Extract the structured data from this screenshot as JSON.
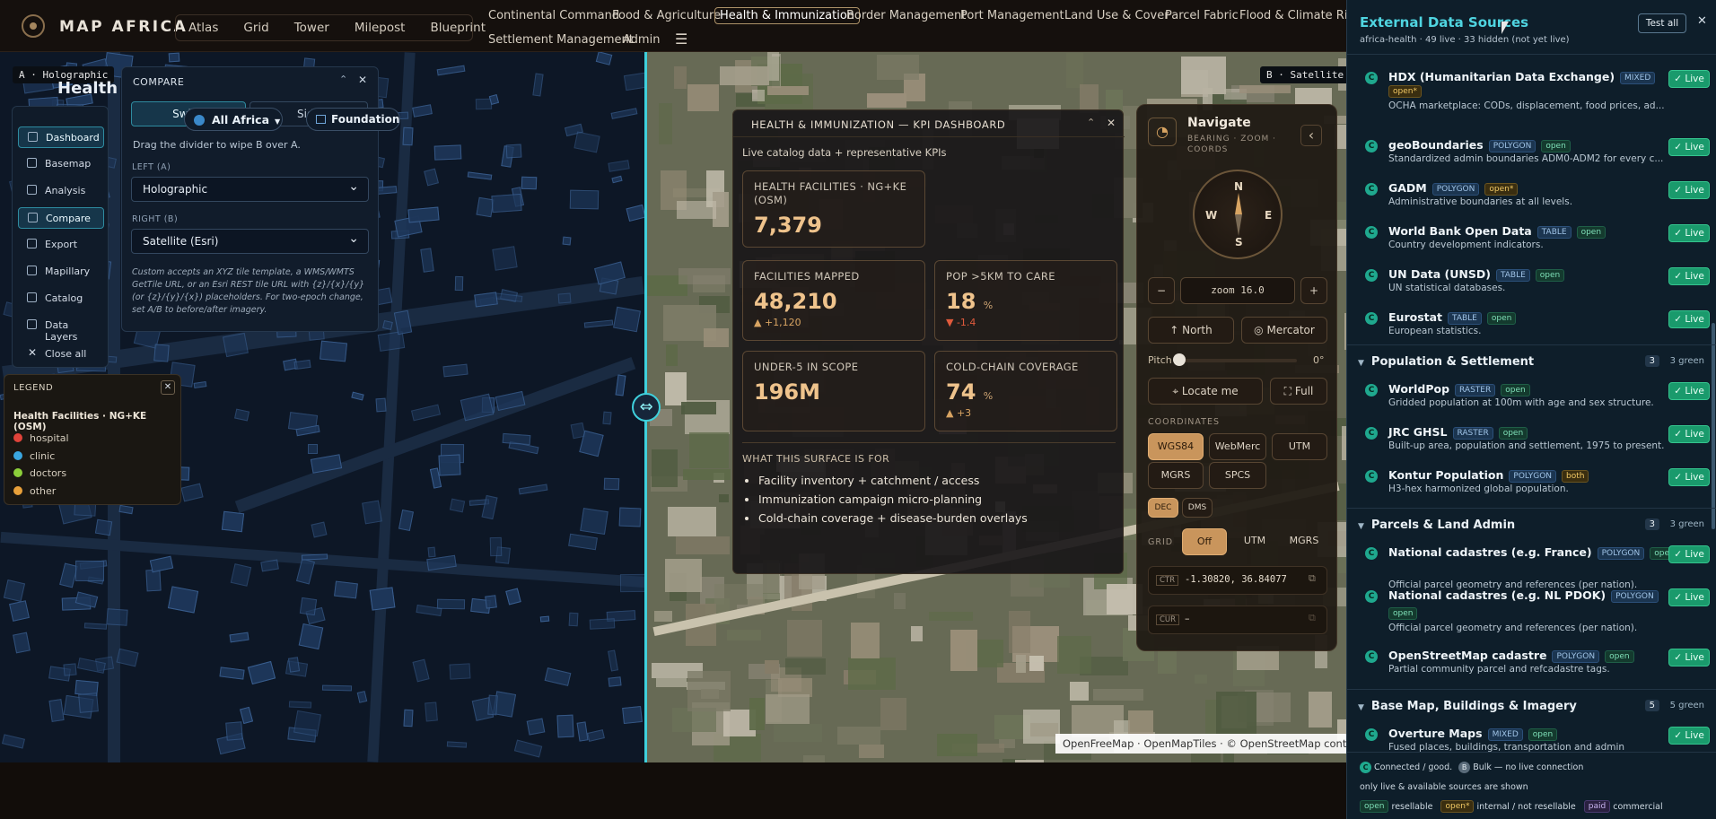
{
  "app": {
    "brand": "MAP AFRICA",
    "modes": [
      "Atlas",
      "Grid",
      "Tower",
      "Milepost",
      "Blueprint"
    ]
  },
  "nav": {
    "items": [
      "Continental Command",
      "Food & Agriculture",
      "Health & Immunization",
      "Border Management",
      "Port Management",
      "Land Use & Cover",
      "Parcel Fabric",
      "Flood & Climate Risk",
      "Settlement Management",
      "Admin"
    ]
  },
  "map": {
    "left_tag": "A · Holographic",
    "right_tag": "B · Satellite",
    "overlay_title": "Health",
    "attribution": "OpenFreeMap · OpenMapTiles · © OpenStreetMap contribu"
  },
  "sidenav": {
    "items": [
      "Dashboard",
      "Basemap",
      "Analysis",
      "Compare",
      "Export",
      "Mapillary",
      "Catalog",
      "Data Layers",
      "Close all"
    ]
  },
  "compare": {
    "title": "COMPARE",
    "mode_active": "Swipe",
    "mode_other": "Side",
    "region": "All Africa",
    "foundation": "Foundation",
    "hint": "Drag the divider to wipe B over A.",
    "left_label": "LEFT (A)",
    "left_value": "Holographic",
    "right_label": "RIGHT (B)",
    "right_value": "Satellite (Esri)",
    "help": "Custom accepts an XYZ tile template, a WMS/WMTS GetTile URL, or an Esri REST tile URL with {z}/{x}/{y} (or {z}/{y}/{x}) placeholders. For two-epoch change, set A/B to before/after imagery."
  },
  "legend": {
    "title": "LEGEND",
    "layer": "Health Facilities · NG+KE (OSM)",
    "items": [
      {
        "label": "hospital",
        "color": "#e0433a"
      },
      {
        "label": "clinic",
        "color": "#3aa6e0"
      },
      {
        "label": "doctors",
        "color": "#8ccf3a"
      },
      {
        "label": "other",
        "color": "#e8a03a"
      }
    ]
  },
  "kpi": {
    "title": "HEALTH & IMMUNIZATION — KPI DASHBOARD",
    "subtitle": "Live catalog data + representative KPIs",
    "c1": {
      "label": "HEALTH FACILITIES · NG+KE (OSM)",
      "value": "7,379"
    },
    "c2": {
      "label": "FACILITIES MAPPED",
      "value": "48,210",
      "delta": "▲ +1,120"
    },
    "c3": {
      "label": "POP >5KM TO CARE",
      "value": "18",
      "unit": "%",
      "delta": "▼ -1.4"
    },
    "c4": {
      "label": "UNDER-5 IN SCOPE",
      "value": "196M"
    },
    "c5": {
      "label": "COLD-CHAIN COVERAGE",
      "value": "74",
      "unit": "%",
      "delta": "▲ +3"
    },
    "purpose_title": "WHAT THIS SURFACE IS FOR",
    "purpose": [
      "Facility inventory + catchment / access",
      "Immunization campaign micro-planning",
      "Cold-chain coverage + disease-burden overlays"
    ]
  },
  "navigate": {
    "title": "Navigate",
    "subtitle": "BEARING · ZOOM · COORDS",
    "zoom": "zoom 16.0",
    "north": "North",
    "projection": "Mercator",
    "pitch_label": "Pitch",
    "pitch": "0°",
    "locate": "Locate me",
    "full": "Full",
    "coords_label": "COORDINATES",
    "coord_systems": [
      "WGS84",
      "WebMerc",
      "UTM",
      "MGRS",
      "SPCS"
    ],
    "formats": [
      "DEC",
      "DMS"
    ],
    "grid_label": "GRID",
    "grid_opts": [
      "Off",
      "UTM",
      "MGRS"
    ],
    "ctr_label": "CTR",
    "ctr": "-1.30820, 36.84077",
    "cur_label": "CUR",
    "cur": "–"
  },
  "sources": {
    "title": "External Data Sources",
    "test_all": "Test all",
    "meta": "africa-health · 49 live · 33 hidden (not yet live)",
    "top": [
      {
        "name": "HDX (Humanitarian Data Exchange)",
        "type": "MIXED",
        "lic": "open*",
        "desc": "OCHA marketplace: CODs, displacement, food prices, ad..."
      },
      {
        "name": "geoBoundaries",
        "type": "POLYGON",
        "lic": "open",
        "desc": "Standardized admin boundaries ADM0-ADM2 for every c..."
      },
      {
        "name": "GADM",
        "type": "POLYGON",
        "lic": "open*",
        "desc": "Administrative boundaries at all levels."
      },
      {
        "name": "World Bank Open Data",
        "type": "TABLE",
        "lic": "open",
        "desc": "Country development indicators."
      },
      {
        "name": "UN Data (UNSD)",
        "type": "TABLE",
        "lic": "open",
        "desc": "UN statistical databases."
      },
      {
        "name": "Eurostat",
        "type": "TABLE",
        "lic": "open",
        "desc": "European statistics."
      }
    ],
    "sections": [
      {
        "title": "Population & Settlement",
        "count": "3",
        "green": "3 green",
        "items": [
          {
            "name": "WorldPop",
            "type": "RASTER",
            "lic": "open",
            "desc": "Gridded population at 100m with age and sex structure."
          },
          {
            "name": "JRC GHSL",
            "type": "RASTER",
            "lic": "open",
            "desc": "Built-up area, population and settlement, 1975 to present."
          },
          {
            "name": "Kontur Population",
            "type": "POLYGON",
            "lic": "both",
            "desc": "H3-hex harmonized global population."
          }
        ]
      },
      {
        "title": "Parcels & Land Admin",
        "count": "3",
        "green": "3 green",
        "items": [
          {
            "name": "National cadastres (e.g. France)",
            "type": "POLYGON",
            "lic": "open",
            "desc": "Official parcel geometry and references (per nation)."
          },
          {
            "name": "National cadastres (e.g. NL PDOK)",
            "type": "POLYGON",
            "lic": "open",
            "desc": "Official parcel geometry and references (per nation)."
          },
          {
            "name": "OpenStreetMap cadastre",
            "type": "POLYGON",
            "lic": "open",
            "desc": "Partial community parcel and refcadastre tags."
          }
        ]
      },
      {
        "title": "Base Map, Buildings & Imagery",
        "count": "5",
        "green": "5 green",
        "items": [
          {
            "name": "Overture Maps",
            "type": "MIXED",
            "lic": "open",
            "desc": "Fused places, buildings, transportation and admin"
          }
        ]
      }
    ],
    "live_label": "✓ Live",
    "footer": {
      "connected": "Connected / good.",
      "bulk": "Bulk — no live connection",
      "only": "only live & available sources are shown",
      "open": "open",
      "resellable": "resellable",
      "open_star": "open*",
      "internal": "internal / not resellable",
      "paid": "paid",
      "commercial": "commercial"
    }
  }
}
